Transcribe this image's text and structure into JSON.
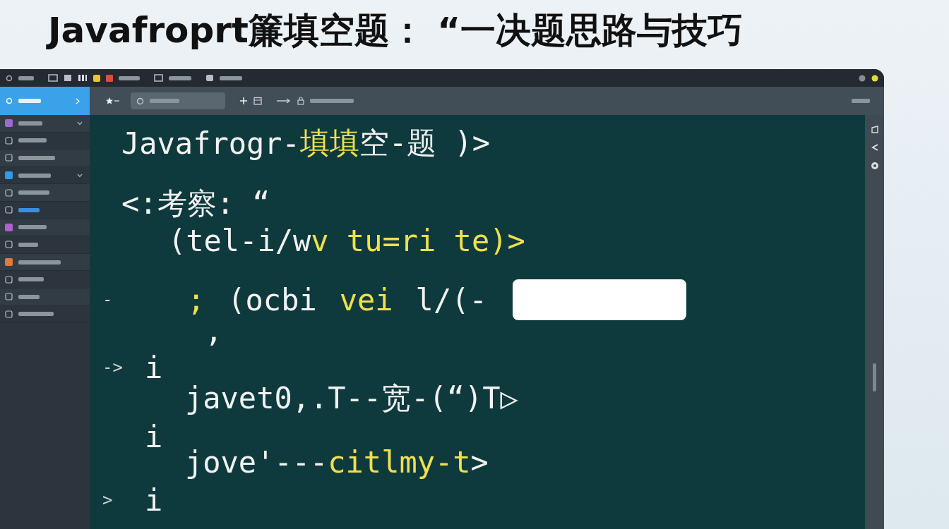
{
  "title": "Javafroprt簾填空题： “一决题思路与技巧",
  "sidebar": {
    "items": [
      {
        "kind": "tile",
        "color": "#9a6ad0",
        "selected": false,
        "chevron": true
      },
      {
        "kind": "outline",
        "selected": false,
        "chevron": false
      },
      {
        "kind": "outline",
        "selected": false,
        "chevron": false
      },
      {
        "kind": "tile",
        "color": "#2f9be0",
        "selected": false,
        "chevron": true
      },
      {
        "kind": "outline",
        "selected": false,
        "chevron": false
      },
      {
        "kind": "outline",
        "selected": true,
        "chevron": false
      },
      {
        "kind": "tile",
        "color": "#b060d0",
        "selected": false,
        "chevron": false
      },
      {
        "kind": "outline",
        "selected": false,
        "chevron": false
      },
      {
        "kind": "tile",
        "color": "#e07a3a",
        "selected": false,
        "chevron": false
      },
      {
        "kind": "outline",
        "selected": false,
        "chevron": false
      },
      {
        "kind": "outline",
        "selected": false,
        "chevron": false
      },
      {
        "kind": "outline",
        "selected": false,
        "chevron": false
      }
    ]
  },
  "editor": {
    "lines": [
      {
        "segments": [
          {
            "kind": "code",
            "text": "Javafrogr-",
            "highlight": false
          },
          {
            "kind": "code",
            "text": "填填",
            "highlight": true
          },
          {
            "kind": "code",
            "text": "空-题 )>",
            "highlight": false
          }
        ]
      },
      {
        "segments": [
          {
            "kind": "code",
            "text": "<:考察: “",
            "highlight": false
          }
        ]
      },
      {
        "segments": [
          {
            "kind": "code",
            "text": "(tel-i/w",
            "highlight": false
          },
          {
            "kind": "code",
            "text": "v tu=ri",
            "highlight": true
          },
          {
            "kind": "code",
            "text": " te)>",
            "highlight": true
          }
        ]
      },
      {
        "gutter": "-",
        "segments": [
          {
            "kind": "code",
            "text": ";",
            "highlight": true
          },
          {
            "kind": "code",
            "text": "(ocbi",
            "highlight": false
          },
          {
            "kind": "code",
            "text": "vei",
            "highlight": true
          },
          {
            "kind": "code",
            "text": "l/(-",
            "highlight": false
          },
          {
            "kind": "blank"
          }
        ]
      },
      {
        "segments": [
          {
            "kind": "code",
            "text": ",",
            "highlight": false
          }
        ]
      },
      {
        "gutter": "->",
        "segments": [
          {
            "kind": "code",
            "text": "i",
            "highlight": false
          }
        ]
      },
      {
        "segments": [
          {
            "kind": "code",
            "text": "javet0,.T--宽-(“)T▷",
            "highlight": false
          }
        ]
      },
      {
        "segments": [
          {
            "kind": "code",
            "text": "i",
            "highlight": false
          }
        ]
      },
      {
        "segments": [
          {
            "kind": "code",
            "text": "jove'---",
            "highlight": false
          },
          {
            "kind": "code",
            "text": "citlmy-t",
            "highlight": true
          },
          {
            "kind": "code",
            "text": ">",
            "highlight": false
          }
        ]
      },
      {
        "gutter": ">",
        "segments": [
          {
            "kind": "code",
            "text": "i",
            "highlight": false
          }
        ]
      }
    ]
  }
}
